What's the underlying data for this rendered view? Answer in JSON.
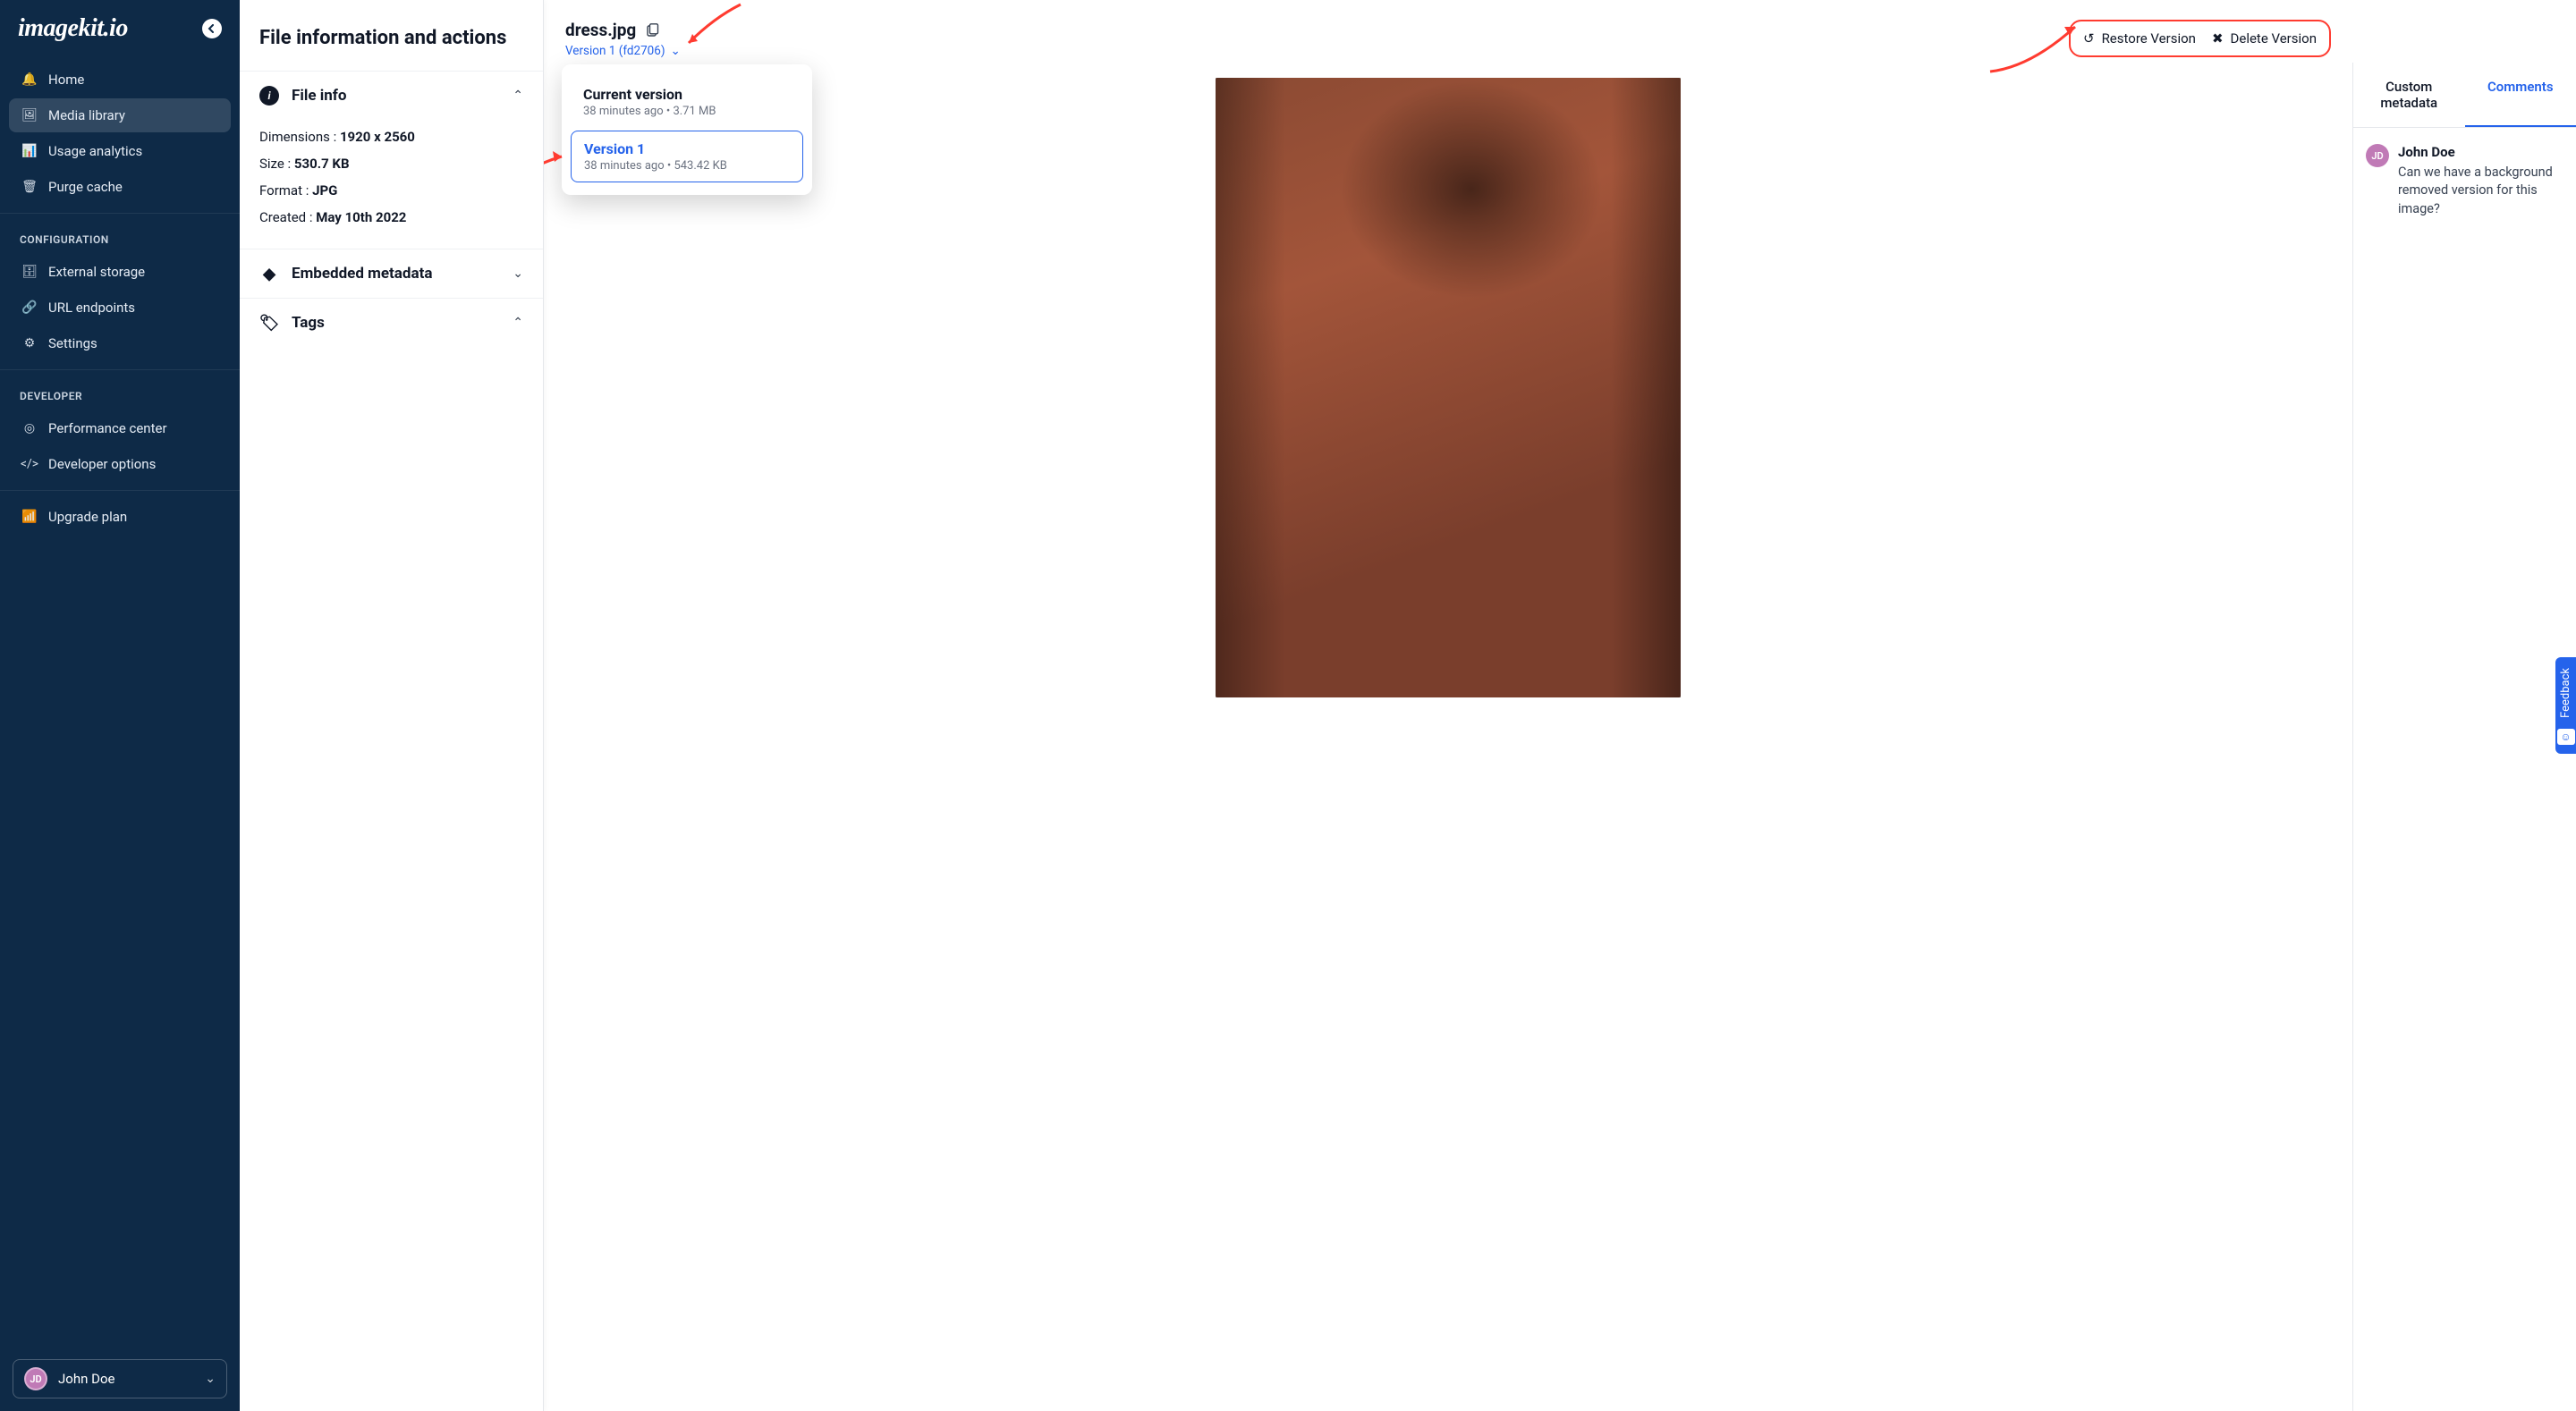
{
  "brand": "imagekit.io",
  "sidebar": {
    "items": [
      {
        "label": "Home",
        "icon": "🔔"
      },
      {
        "label": "Media library",
        "icon": "🖼"
      },
      {
        "label": "Usage analytics",
        "icon": "📊"
      },
      {
        "label": "Purge cache",
        "icon": "🗑"
      }
    ],
    "config_heading": "CONFIGURATION",
    "config_items": [
      {
        "label": "External storage",
        "icon": "🗄"
      },
      {
        "label": "URL endpoints",
        "icon": "🔗"
      },
      {
        "label": "Settings",
        "icon": "⚙"
      }
    ],
    "dev_heading": "DEVELOPER",
    "dev_items": [
      {
        "label": "Performance center",
        "icon": "◎"
      },
      {
        "label": "Developer options",
        "icon": "</>"
      }
    ],
    "upgrade_label": "Upgrade plan",
    "upgrade_icon": "📶",
    "user": {
      "initials": "JD",
      "name": "John Doe"
    }
  },
  "info_panel": {
    "title": "File information and actions",
    "sections": {
      "file_info_label": "File info",
      "embedded_label": "Embedded metadata",
      "tags_label": "Tags"
    },
    "file_info": {
      "dimensions_label": "Dimensions :",
      "dimensions_value": "1920 x 2560",
      "size_label": "Size :",
      "size_value": "530.7 KB",
      "format_label": "Format :",
      "format_value": "JPG",
      "created_label": "Created :",
      "created_value": "May 10th 2022"
    }
  },
  "file": {
    "name": "dress.jpg",
    "version_label": "Version 1 (fd2706)"
  },
  "versions": {
    "current": {
      "title": "Current version",
      "sub": "38 minutes ago • 3.71 MB"
    },
    "v1": {
      "title": "Version 1",
      "sub": "38 minutes ago • 543.42 KB"
    }
  },
  "actions": {
    "restore": "Restore Version",
    "delete": "Delete Version"
  },
  "right": {
    "tab_meta": "Custom metadata",
    "tab_comments": "Comments",
    "comment": {
      "initials": "JD",
      "author": "John Doe",
      "text": "Can we have a background removed version for this image?"
    }
  },
  "feedback_label": "Feedback"
}
